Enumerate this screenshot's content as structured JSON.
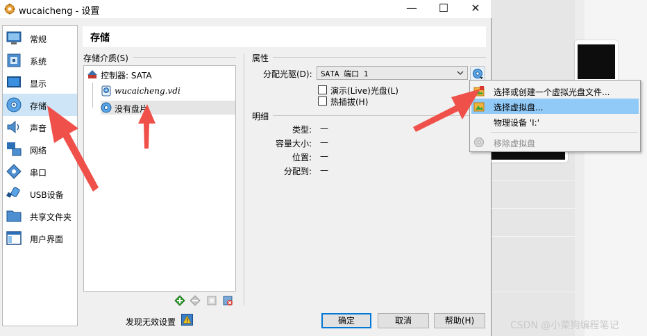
{
  "window": {
    "title": "wucaicheng - 设置"
  },
  "sidebar": {
    "items": [
      {
        "label": "常规",
        "icon": "general-icon"
      },
      {
        "label": "系统",
        "icon": "system-icon"
      },
      {
        "label": "显示",
        "icon": "display-icon"
      },
      {
        "label": "存储",
        "icon": "storage-icon",
        "selected": true
      },
      {
        "label": "声音",
        "icon": "audio-icon"
      },
      {
        "label": "网络",
        "icon": "network-icon"
      },
      {
        "label": "串口",
        "icon": "serial-port-icon"
      },
      {
        "label": "USB设备",
        "icon": "usb-icon"
      },
      {
        "label": "共享文件夹",
        "icon": "shared-folder-icon"
      },
      {
        "label": "用户界面",
        "icon": "user-interface-icon"
      }
    ]
  },
  "page": {
    "title": "存储"
  },
  "storage_media": {
    "label": "存储介质(S)",
    "controller": "控制器: SATA",
    "items": [
      {
        "label": "wucaicheng.vdi",
        "type": "hard-disk"
      },
      {
        "label": "没有盘片",
        "type": "optical",
        "selected": true
      }
    ]
  },
  "attributes": {
    "label": "属性",
    "drive_label": "分配光驱(D):",
    "drive_value": "SATA 端口 1",
    "live_cd_label": "演示(Live)光盘(L)",
    "hotplug_label": "热插拔(H)"
  },
  "details": {
    "label": "明细",
    "rows": [
      {
        "key": "类型:",
        "value": "—"
      },
      {
        "key": "容量大小:",
        "value": "—"
      },
      {
        "key": "位置:",
        "value": "—"
      },
      {
        "key": "分配到:",
        "value": "—"
      }
    ]
  },
  "context_menu": {
    "items": [
      {
        "label": "选择或创建一个虚拟光盘文件...",
        "enabled": true
      },
      {
        "label": "选择虚拟盘...",
        "enabled": true,
        "highlighted": true
      },
      {
        "label": "物理设备 'I:'",
        "enabled": true
      },
      {
        "label": "移除虚拟盘",
        "enabled": false
      }
    ]
  },
  "footer": {
    "invalid_settings": "发现无效设置",
    "ok": "确定",
    "cancel": "取消",
    "help": "帮助(H)"
  },
  "watermark": "CSDN @小菜狗编程笔记",
  "colors": {
    "selection": "#cde5f7",
    "menu_highlight": "#91c9f7",
    "annotation_arrow": "#f0504a",
    "primary_border": "#0078d7"
  }
}
